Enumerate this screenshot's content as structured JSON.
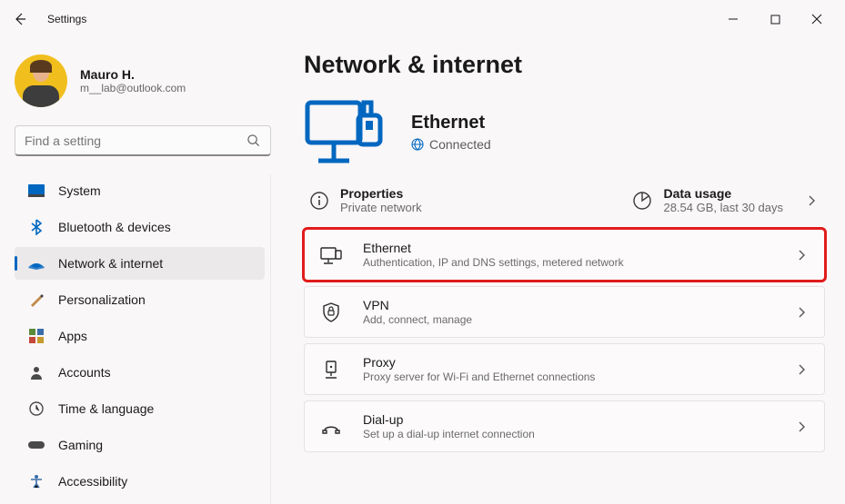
{
  "window": {
    "title": "Settings"
  },
  "user": {
    "name": "Mauro H.",
    "email": "m__lab@outlook.com"
  },
  "search": {
    "placeholder": "Find a setting"
  },
  "sidebar": {
    "items": [
      {
        "label": "System",
        "icon": "system"
      },
      {
        "label": "Bluetooth & devices",
        "icon": "bluetooth"
      },
      {
        "label": "Network & internet",
        "icon": "network",
        "active": true
      },
      {
        "label": "Personalization",
        "icon": "personalization"
      },
      {
        "label": "Apps",
        "icon": "apps"
      },
      {
        "label": "Accounts",
        "icon": "accounts"
      },
      {
        "label": "Time & language",
        "icon": "time"
      },
      {
        "label": "Gaming",
        "icon": "gaming"
      },
      {
        "label": "Accessibility",
        "icon": "accessibility"
      }
    ]
  },
  "page": {
    "title": "Network & internet",
    "hero": {
      "title": "Ethernet",
      "status": "Connected"
    },
    "summary": {
      "left": {
        "title": "Properties",
        "sub": "Private network"
      },
      "right": {
        "title": "Data usage",
        "sub": "28.54 GB, last 30 days"
      }
    },
    "cards": [
      {
        "id": "ethernet",
        "title": "Ethernet",
        "sub": "Authentication, IP and DNS settings, metered network",
        "icon": "ethernet",
        "highlight": true
      },
      {
        "id": "vpn",
        "title": "VPN",
        "sub": "Add, connect, manage",
        "icon": "vpn"
      },
      {
        "id": "proxy",
        "title": "Proxy",
        "sub": "Proxy server for Wi-Fi and Ethernet connections",
        "icon": "proxy"
      },
      {
        "id": "dialup",
        "title": "Dial-up",
        "sub": "Set up a dial-up internet connection",
        "icon": "dialup"
      }
    ]
  }
}
